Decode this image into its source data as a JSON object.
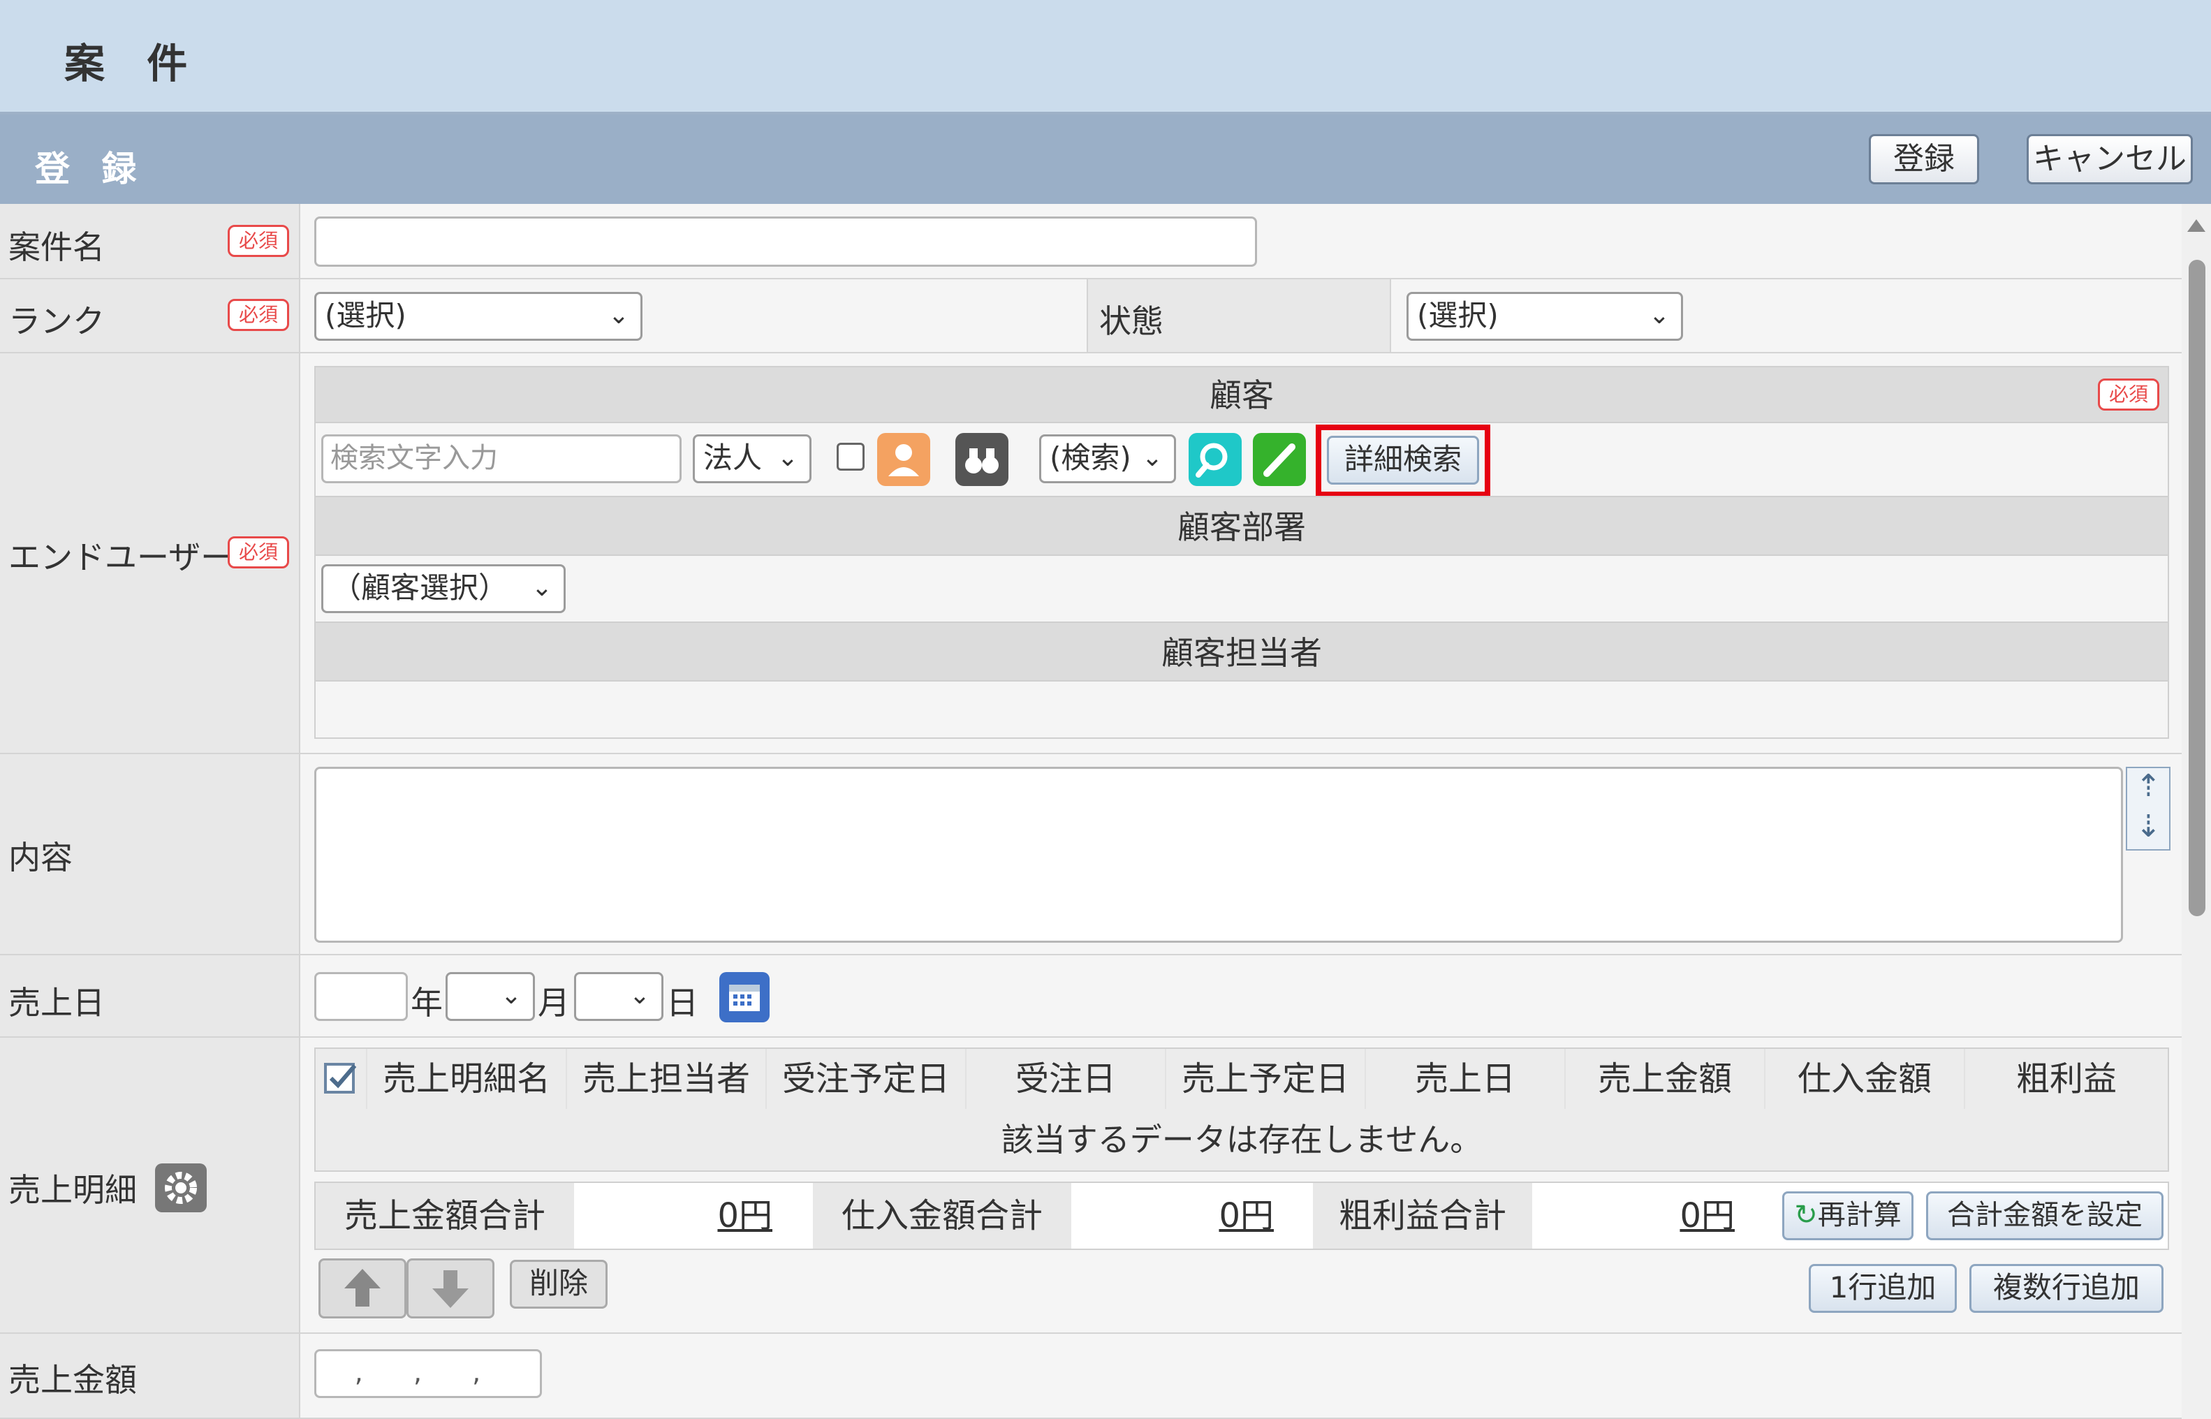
{
  "page": {
    "title": "案 件"
  },
  "section": {
    "title": "登 録",
    "register_label": "登録",
    "cancel_label": "キャンセル"
  },
  "required_label": "必須",
  "fields": {
    "anken_name": {
      "label": "案件名",
      "value": ""
    },
    "rank": {
      "label": "ランク",
      "selected": "(選択)"
    },
    "status": {
      "label": "状態",
      "selected": "(選択)"
    },
    "end_user": {
      "label": "エンドユーザー",
      "customer_header": "顧客",
      "search_placeholder": "検索文字入力",
      "entity_type": "法人",
      "search_mode": "(検索)",
      "detail_search_label": "詳細検索",
      "dept_header": "顧客部署",
      "dept_select": "（顧客選択）",
      "contact_header": "顧客担当者"
    },
    "content": {
      "label": "内容",
      "value": ""
    },
    "sales_date": {
      "label": "売上日",
      "year_unit": "年",
      "month_unit": "月",
      "day_unit": "日"
    },
    "sales_details": {
      "label": "売上明細",
      "columns": [
        "売上明細名",
        "売上担当者",
        "受注予定日",
        "受注日",
        "売上予定日",
        "売上日",
        "売上金額",
        "仕入金額",
        "粗利益"
      ],
      "empty_message": "該当するデータは存在しません。",
      "sales_total_label": "売上金額合計",
      "sales_total_value": "0円",
      "purchase_total_label": "仕入金額合計",
      "purchase_total_value": "0円",
      "profit_total_label": "粗利益合計",
      "profit_total_value": "0円",
      "recalc_label": "再計算",
      "set_total_label": "合計金額を設定",
      "delete_label": "削除",
      "add_one_label": "1行追加",
      "add_many_label": "複数行追加"
    },
    "sales_amount": {
      "label": "売上金額",
      "value": ", , ,"
    }
  },
  "colors": {
    "title_bg": "#cbdcec",
    "section_bg": "#9aafc7",
    "required": "#e84a4a",
    "highlight": "#e60012"
  }
}
